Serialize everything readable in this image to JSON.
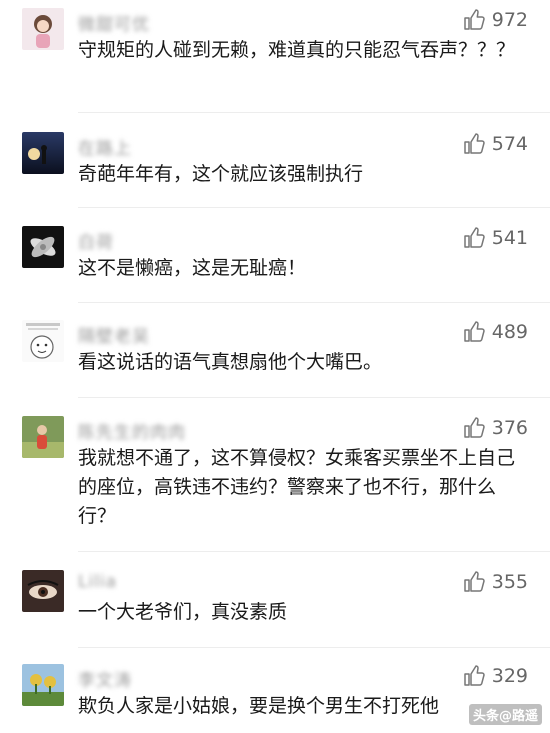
{
  "comments": [
    {
      "name": "微甜可优",
      "likes": "972",
      "text": "守规矩的人碰到无赖，难道真的只能忍气吞声？？？"
    },
    {
      "name": "在路上",
      "likes": "574",
      "text": "奇葩年年有，这个就应该强制执行"
    },
    {
      "name": "白荷",
      "likes": "541",
      "text": "这不是懒癌，这是无耻癌！"
    },
    {
      "name": "隔壁老吴",
      "likes": "489",
      "text": "看这说话的语气真想扇他个大嘴巴。"
    },
    {
      "name": "陈先生的肉肉",
      "likes": "376",
      "text": "我就想不通了，这不算侵权？女乘客买票坐不上自己的座位，高铁违不违约？警察来了也不行，那什么行？"
    },
    {
      "name": "Lilia",
      "likes": "355",
      "text": "一个大老爷们，真没素质"
    },
    {
      "name": "李文涛",
      "likes": "329",
      "text": "欺负人家是小姑娘，要是换个男生不打死他"
    }
  ],
  "icons": {
    "like": "thumbs-up-icon"
  },
  "watermark": "头条@路遥"
}
